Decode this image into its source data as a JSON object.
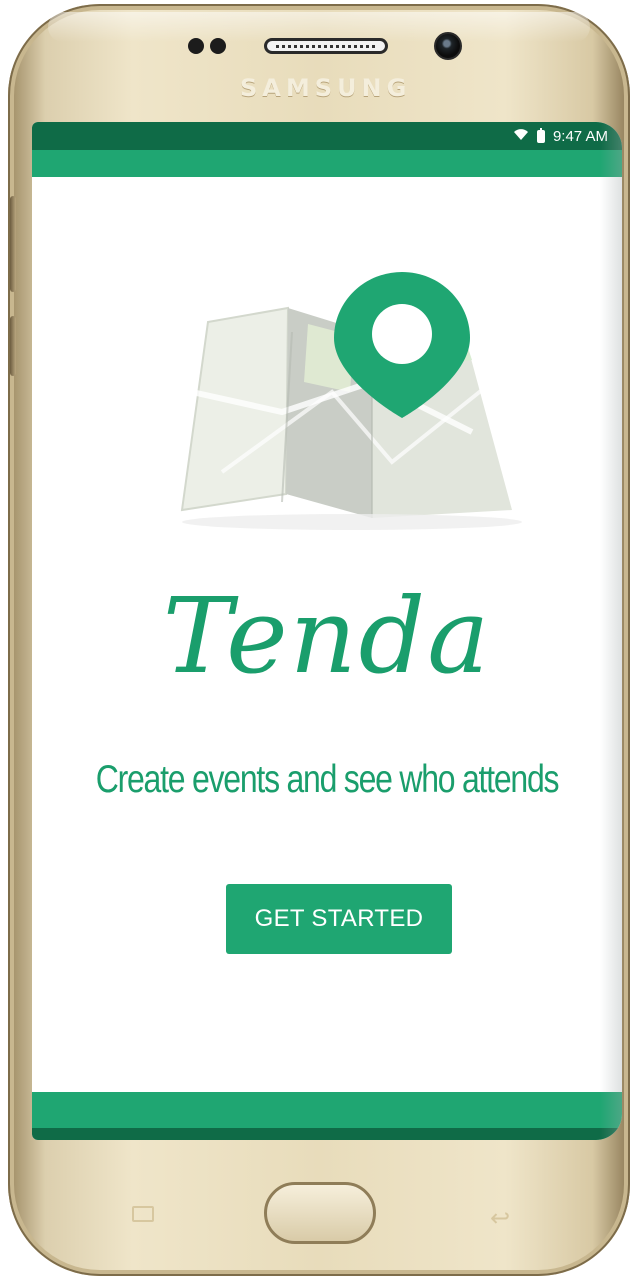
{
  "device": {
    "brand": "SAMSUNG"
  },
  "status_bar": {
    "time": "9:47 AM",
    "wifi_icon": "wifi-icon",
    "battery_icon": "battery-icon"
  },
  "app": {
    "title": "Tenda",
    "tagline": "Create events and see who attends",
    "cta_label": "GET STARTED"
  },
  "hero": {
    "icon": "map-with-location-pin"
  },
  "colors": {
    "brand_green": "#1fa672",
    "dark_green": "#0f6b47",
    "text_green": "#1a9e6c",
    "gold_frame": "#e8dcbb"
  }
}
